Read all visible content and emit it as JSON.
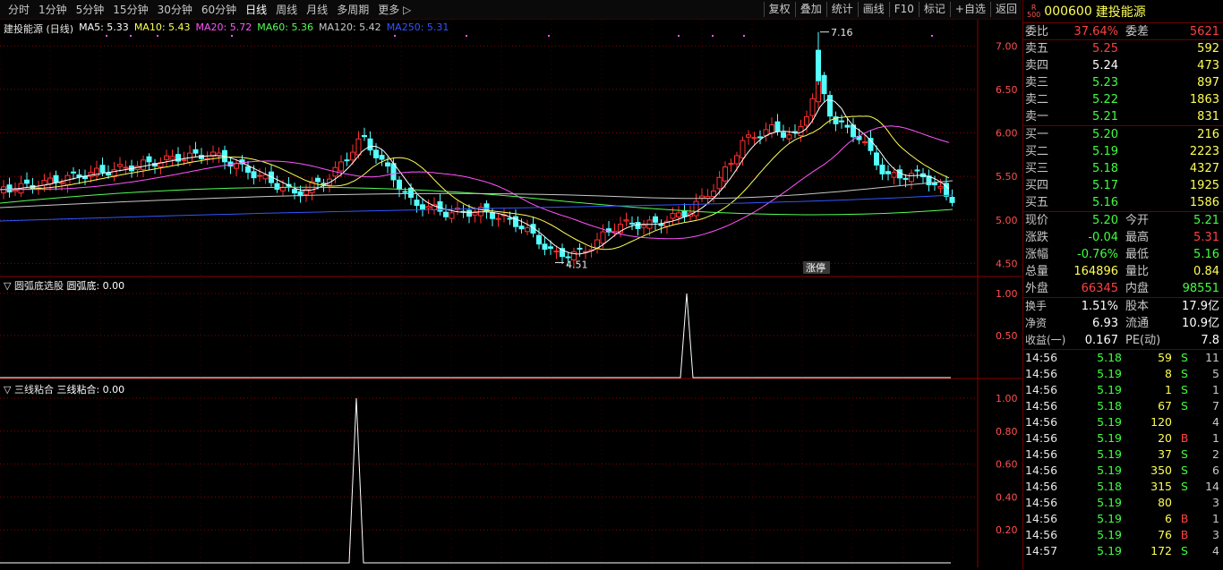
{
  "toolbar": {
    "tabs": [
      "分时",
      "1分钟",
      "5分钟",
      "15分钟",
      "30分钟",
      "60分钟",
      "日线",
      "周线",
      "月线",
      "多周期",
      "更多 ▷"
    ],
    "active_tab": "日线",
    "tools": [
      "复权",
      "叠加",
      "统计",
      "画线",
      "F10",
      "标记",
      "+自选",
      "返回"
    ]
  },
  "main_chart": {
    "title": "建投能源 (日线)",
    "ma": [
      {
        "label": "MA5: 5.33",
        "color": "#ffffff"
      },
      {
        "label": "MA10: 5.43",
        "color": "#ffff55"
      },
      {
        "label": "MA20: 5.72",
        "color": "#ff55ff"
      },
      {
        "label": "MA60: 5.36",
        "color": "#55ff55"
      },
      {
        "label": "MA120: 5.42",
        "color": "#c8c8c8"
      },
      {
        "label": "MA250: 5.31",
        "color": "#3355ff"
      }
    ],
    "y_ticks": [
      "7.00",
      "6.50",
      "6.00",
      "5.50",
      "5.00",
      "4.50"
    ],
    "high_label": "7.16",
    "low_label": "4.51",
    "marker_label": "涨停"
  },
  "indicator1": {
    "title": "圆弧底选股",
    "value_label": "圆弧底: 0.00",
    "y_ticks": [
      "1.00",
      "0.50"
    ]
  },
  "indicator2": {
    "title": "三线粘合",
    "value_label": "三线粘合: 0.00",
    "y_ticks": [
      "1.00",
      "0.80",
      "0.60",
      "0.40",
      "0.20"
    ]
  },
  "quote": {
    "badge_top": "R",
    "badge_bottom": "500",
    "code": "000600",
    "name": "建投能源",
    "weibi_label": "委比",
    "weibi": "37.64%",
    "weicha_label": "委差",
    "weicha": "5621",
    "asks": [
      {
        "label": "卖五",
        "price": "5.25",
        "vol": "592",
        "pc": "red"
      },
      {
        "label": "卖四",
        "price": "5.24",
        "vol": "473",
        "pc": "white"
      },
      {
        "label": "卖三",
        "price": "5.23",
        "vol": "897",
        "pc": "green"
      },
      {
        "label": "卖二",
        "price": "5.22",
        "vol": "1863",
        "pc": "green"
      },
      {
        "label": "卖一",
        "price": "5.21",
        "vol": "831",
        "pc": "green"
      }
    ],
    "bids": [
      {
        "label": "买一",
        "price": "5.20",
        "vol": "216",
        "pc": "green"
      },
      {
        "label": "买二",
        "price": "5.19",
        "vol": "2223",
        "pc": "green"
      },
      {
        "label": "买三",
        "price": "5.18",
        "vol": "4327",
        "pc": "green"
      },
      {
        "label": "买四",
        "price": "5.17",
        "vol": "1925",
        "pc": "green"
      },
      {
        "label": "买五",
        "price": "5.16",
        "vol": "1586",
        "pc": "green"
      }
    ],
    "stats": [
      {
        "l1": "现价",
        "v1": "5.20",
        "c1": "green",
        "l2": "今开",
        "v2": "5.21",
        "c2": "green"
      },
      {
        "l1": "涨跌",
        "v1": "-0.04",
        "c1": "green",
        "l2": "最高",
        "v2": "5.31",
        "c2": "red"
      },
      {
        "l1": "涨幅",
        "v1": "-0.76%",
        "c1": "green",
        "l2": "最低",
        "v2": "5.16",
        "c2": "green"
      },
      {
        "l1": "总量",
        "v1": "164896",
        "c1": "yellow",
        "l2": "量比",
        "v2": "0.84",
        "c2": "yellow"
      },
      {
        "l1": "外盘",
        "v1": "66345",
        "c1": "red",
        "l2": "内盘",
        "v2": "98551",
        "c2": "green"
      }
    ],
    "stats2": [
      {
        "l1": "换手",
        "v1": "1.51%",
        "l2": "股本",
        "v2": "17.9亿"
      },
      {
        "l1": "净资",
        "v1": "6.93",
        "l2": "流通",
        "v2": "10.9亿"
      },
      {
        "l1": "收益(一)",
        "v1": "0.167",
        "l2": "PE(动)",
        "v2": "7.8"
      }
    ]
  },
  "ticks": [
    {
      "time": "14:56",
      "price": "5.18",
      "vol": "59",
      "dir": "S",
      "n": "11"
    },
    {
      "time": "14:56",
      "price": "5.19",
      "vol": "8",
      "dir": "S",
      "n": "5"
    },
    {
      "time": "14:56",
      "price": "5.19",
      "vol": "1",
      "dir": "S",
      "n": "1"
    },
    {
      "time": "14:56",
      "price": "5.18",
      "vol": "67",
      "dir": "S",
      "n": "7"
    },
    {
      "time": "14:56",
      "price": "5.19",
      "vol": "120",
      "dir": "",
      "n": "4"
    },
    {
      "time": "14:56",
      "price": "5.19",
      "vol": "20",
      "dir": "B",
      "n": "1"
    },
    {
      "time": "14:56",
      "price": "5.19",
      "vol": "37",
      "dir": "S",
      "n": "2"
    },
    {
      "time": "14:56",
      "price": "5.19",
      "vol": "350",
      "dir": "S",
      "n": "6"
    },
    {
      "time": "14:56",
      "price": "5.18",
      "vol": "315",
      "dir": "S",
      "n": "14"
    },
    {
      "time": "14:56",
      "price": "5.19",
      "vol": "80",
      "dir": "",
      "n": "3"
    },
    {
      "time": "14:56",
      "price": "5.19",
      "vol": "6",
      "dir": "B",
      "n": "1"
    },
    {
      "time": "14:56",
      "price": "5.19",
      "vol": "76",
      "dir": "B",
      "n": "3"
    },
    {
      "time": "14:57",
      "price": "5.19",
      "vol": "172",
      "dir": "S",
      "n": "4"
    }
  ],
  "colors": {
    "up": "#ff3030",
    "down": "#54ffff",
    "grid": "#8b0000"
  }
}
